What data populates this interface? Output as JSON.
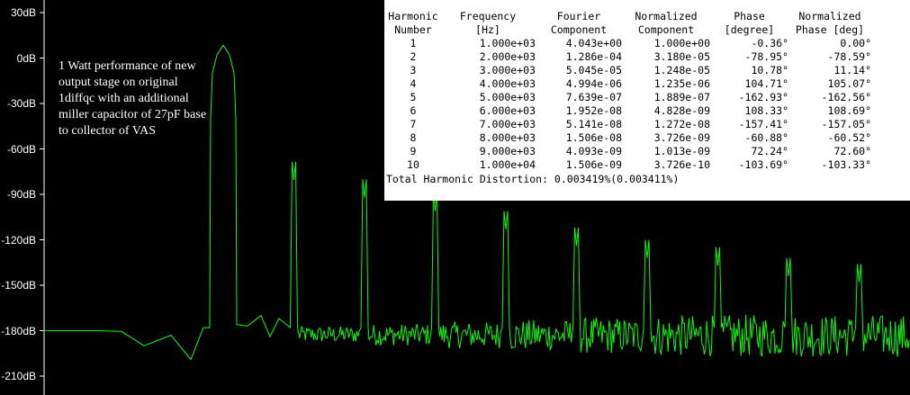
{
  "chart_data": {
    "type": "line",
    "title": "",
    "xlabel": "",
    "ylabel": "",
    "x_unit": "Hz",
    "ylim": [
      -220,
      30
    ],
    "yticks": [
      "30dB",
      "0dB",
      "-30dB",
      "-60dB",
      "-90dB",
      "-120dB",
      "-150dB",
      "-180dB",
      "-210dB"
    ],
    "trace_color": "#00ff00",
    "background": "#000000",
    "grid": false,
    "noise_floor_db": -180,
    "harmonics": [
      {
        "n": 1,
        "freq": 1000,
        "peak_db": 8.5
      },
      {
        "n": 2,
        "freq": 2000,
        "peak_db": -80.5
      },
      {
        "n": 3,
        "freq": 3000,
        "peak_db": -92
      },
      {
        "n": 4,
        "freq": 4000,
        "peak_db": -101
      },
      {
        "n": 5,
        "freq": 5000,
        "peak_db": -113
      },
      {
        "n": 6,
        "freq": 6000,
        "peak_db": -124
      },
      {
        "n": 7,
        "freq": 7000,
        "peak_db": -132
      },
      {
        "n": 8,
        "freq": 8000,
        "peak_db": -137
      },
      {
        "n": 9,
        "freq": 9000,
        "peak_db": -144
      },
      {
        "n": 10,
        "freq": 10000,
        "peak_db": -148
      }
    ],
    "annotation": "1 Watt performance of new output stage on original 1diffqc with an additional miller capacitor of 27pF base to collector of VAS"
  },
  "fourier_table": {
    "headers": [
      [
        "Harmonic",
        "Number"
      ],
      [
        "Frequency",
        "[Hz]"
      ],
      [
        "Fourier",
        "Component"
      ],
      [
        "Normalized",
        "Component"
      ],
      [
        "Phase",
        "[degree]"
      ],
      [
        "Normalized",
        "Phase [deg]"
      ]
    ],
    "rows": [
      [
        "1",
        "1.000e+03",
        "4.043e+00",
        "1.000e+00",
        "-0.36°",
        "0.00°"
      ],
      [
        "2",
        "2.000e+03",
        "1.286e-04",
        "3.180e-05",
        "-78.95°",
        "-78.59°"
      ],
      [
        "3",
        "3.000e+03",
        "5.045e-05",
        "1.248e-05",
        "10.78°",
        "11.14°"
      ],
      [
        "4",
        "4.000e+03",
        "4.994e-06",
        "1.235e-06",
        "104.71°",
        "105.07°"
      ],
      [
        "5",
        "5.000e+03",
        "7.639e-07",
        "1.889e-07",
        "-162.93°",
        "-162.56°"
      ],
      [
        "6",
        "6.000e+03",
        "1.952e-08",
        "4.828e-09",
        "108.33°",
        "108.69°"
      ],
      [
        "7",
        "7.000e+03",
        "5.141e-08",
        "1.272e-08",
        "-157.41°",
        "-157.05°"
      ],
      [
        "8",
        "8.000e+03",
        "1.506e-08",
        "3.726e-09",
        "-60.88°",
        "-60.52°"
      ],
      [
        "9",
        "9.000e+03",
        "4.093e-09",
        "1.013e-09",
        "72.24°",
        "72.60°"
      ],
      [
        "10",
        "1.000e+04",
        "1.506e-09",
        "3.726e-10",
        "-103.69°",
        "-103.33°"
      ]
    ],
    "thd": "Total Harmonic Distortion: 0.003419%(0.003411%)"
  }
}
